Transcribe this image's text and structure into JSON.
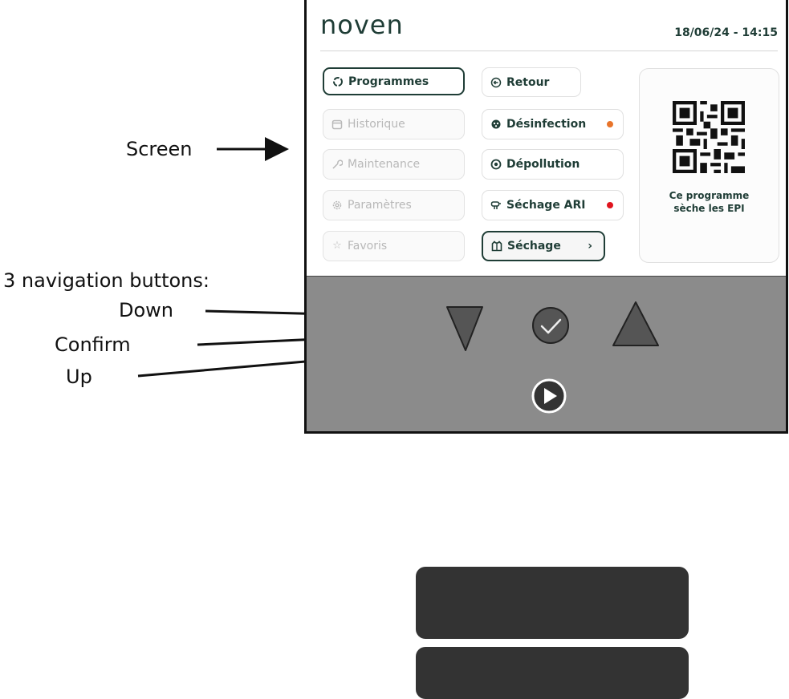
{
  "callouts": {
    "screen": "Screen",
    "nav_buttons": "3 navigation buttons:",
    "down": "Down",
    "confirm": "Confirm",
    "up": "Up"
  },
  "header": {
    "logo": "noven",
    "datetime": "18/06/24 - 14:15"
  },
  "menu_left": [
    {
      "label": "Programmes",
      "icon": "refresh-icon",
      "state": "active"
    },
    {
      "label": "Historique",
      "icon": "calendar-icon",
      "state": "disabled"
    },
    {
      "label": "Maintenance",
      "icon": "wrench-icon",
      "state": "disabled"
    },
    {
      "label": "Paramètres",
      "icon": "gear-icon",
      "state": "disabled"
    },
    {
      "label": "Favoris",
      "icon": "star-icon",
      "state": "disabled"
    }
  ],
  "menu_right": [
    {
      "label": "Retour",
      "icon": "back-arrow-icon"
    },
    {
      "label": "Désinfection",
      "icon": "virus-icon",
      "dot_color": "#e8742a"
    },
    {
      "label": "Dépollution",
      "icon": "filter-icon"
    },
    {
      "label": "Séchage ARI",
      "icon": "mask-icon",
      "dot_color": "#e0141e"
    },
    {
      "label": "Séchage",
      "icon": "jacket-icon",
      "selected": true
    }
  ],
  "info_card": {
    "line1": "Ce programme",
    "line2": "sèche les EPI"
  },
  "colors": {
    "brand": "#1f3d36",
    "panel": "#8b8b8b",
    "button_box": "#333333"
  }
}
